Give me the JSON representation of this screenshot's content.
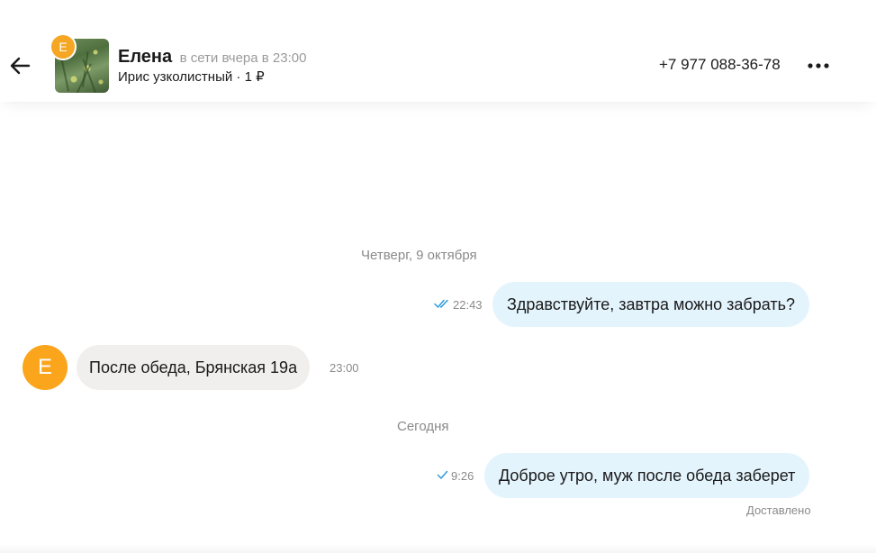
{
  "header": {
    "contact_name": "Елена",
    "status": "в сети вчера в 23:00",
    "item_title": "Ирис узколистный · 1 ₽",
    "avatar_letter": "Е",
    "phone": "+7 977 088-36-78"
  },
  "messages": [
    {
      "type": "date",
      "text": "Четверг, 9 октября"
    },
    {
      "type": "outgoing",
      "text": "Здравствуйте, завтра можно забрать?",
      "time": "22:43",
      "read": true
    },
    {
      "type": "incoming",
      "text": "После обеда, Брянская 19а",
      "time": "23:00",
      "avatar_letter": "Е"
    },
    {
      "type": "date",
      "text": "Сегодня"
    },
    {
      "type": "outgoing",
      "text": "Доброе утро, муж после обеда заберет",
      "time": "9:26",
      "read": false
    }
  ],
  "delivery_status": "Доставлено",
  "colors": {
    "accent_orange": "#fba51c",
    "outgoing_bubble": "#e4f4fd",
    "incoming_bubble": "#f0efed",
    "check_blue": "#2d9cdb"
  },
  "icons": {
    "back": "arrow-left-icon",
    "more": "more-horizontal-icon",
    "read": "double-check-icon",
    "sent": "check-icon"
  }
}
